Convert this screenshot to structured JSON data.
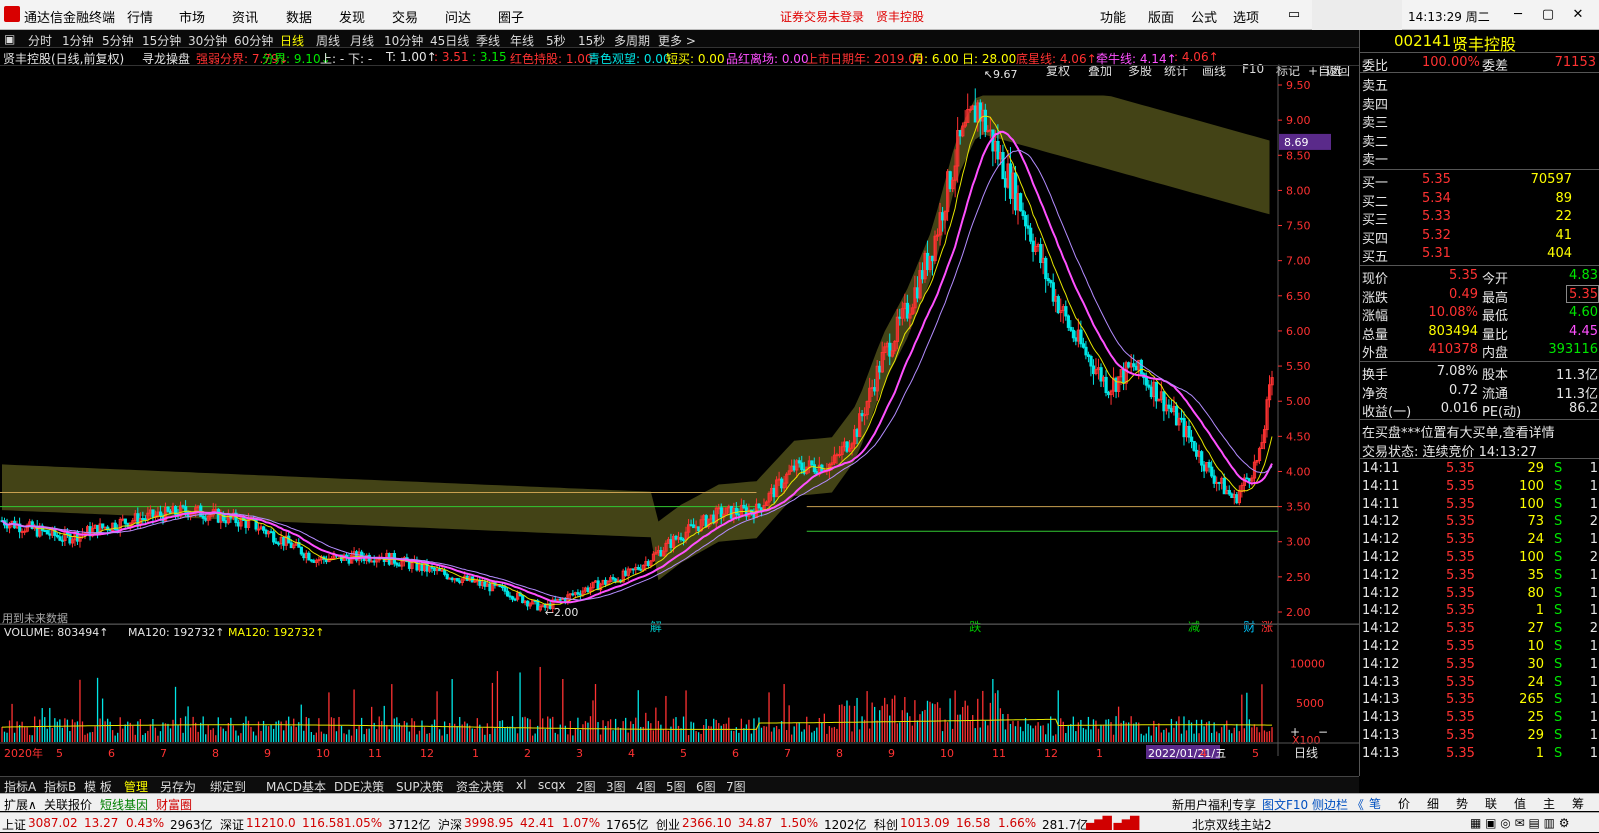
{
  "title_bar": {
    "app_name": "通达信金融终端",
    "menu": [
      "行情",
      "市场",
      "资讯",
      "数据",
      "发现",
      "交易",
      "问达",
      "圈子"
    ],
    "notice_login": "证券交易未登录",
    "notice_stock": "贤丰控股",
    "right_menu": [
      "功能",
      "版面",
      "公式",
      "选项"
    ],
    "clock": "14:13:29 周二"
  },
  "period_bar": {
    "items": [
      "分时",
      "1分钟",
      "5分钟",
      "15分钟",
      "30分钟",
      "60分钟",
      "日线",
      "周线",
      "月线",
      "10分钟",
      "45日线",
      "季线",
      "年线",
      "5秒",
      "15秒",
      "多周期",
      "更多 >"
    ],
    "active": "日线",
    "tool_buttons": [
      "复权",
      "叠加",
      "多股",
      "统计",
      "画线",
      "F10",
      "标记",
      "+自选",
      "返回"
    ]
  },
  "info_bar": {
    "stock_title": "贤丰控股(日线,前复权)",
    "indicator": "寻龙操盘",
    "items": [
      {
        "text": "强弱分界: 7.79↓",
        "color": "#ff3232"
      },
      {
        "text": "分界: 9.10↓",
        "color": "#00e600"
      },
      {
        "text": "上: - 下: -",
        "color": "#e6e6e6"
      },
      {
        "text": "T: 1.00↑",
        "color": "#e6e6e6"
      },
      {
        "text": ": 3.51",
        "color": "#ff3232"
      },
      {
        "text": ": 3.15",
        "color": "#00e600"
      },
      {
        "text": "红色持股: 1.00",
        "color": "#ff3232"
      },
      {
        "text": "青色观望: 0.00",
        "color": "#00e6e6"
      },
      {
        "text": "短买: 0.00",
        "color": "#ffff00"
      },
      {
        "text": "品红离场: 0.00",
        "color": "#ff50ff"
      },
      {
        "text": "上市日期年: 2019.00",
        "color": "#ff3232"
      },
      {
        "text": "月: 6.00",
        "color": "#ffff00"
      },
      {
        "text": "日: 28.00",
        "color": "#ffff00"
      },
      {
        "text": "底星线: 4.06↑",
        "color": "#ff3232"
      },
      {
        "text": "牵牛线: 4.14↑",
        "color": "#ff50ff"
      },
      {
        "text": ": 4.06↑",
        "color": "#ff3232"
      }
    ]
  },
  "chart": {
    "high_label": "9.67",
    "low_label": "2.00",
    "future_note": "用到未来数据",
    "price_axis": [
      "9.50",
      "9.00",
      "8.50",
      "8.00",
      "7.50",
      "7.00",
      "6.50",
      "6.00",
      "5.50",
      "5.00",
      "4.50",
      "4.00",
      "3.50",
      "3.00",
      "2.50",
      "2.00"
    ],
    "current_price_tag": "8.69",
    "markers": [
      "解",
      "跌",
      "减",
      "财",
      "涨"
    ],
    "date_axis": [
      "2020年",
      "5",
      "6",
      "7",
      "8",
      "9",
      "10",
      "11",
      "12",
      "1",
      "2",
      "3",
      "4",
      "5",
      "6",
      "7",
      "8",
      "9",
      "10",
      "11",
      "12",
      "1",
      "2022/01/21/五",
      "4",
      "5"
    ],
    "period_label": "日线"
  },
  "volume_bar": {
    "label": "VOLUME: 803494↑",
    "ma1": "MA120: 192732↑",
    "ma2": "MA120: 192732↑",
    "axis": [
      "10000",
      "5000",
      "X100"
    ]
  },
  "bottom_tabs": [
    "指标A",
    "指标B",
    "模 板",
    "管理",
    "另存为",
    "绑定到",
    "MACD基本",
    "DDE决策",
    "SUP决策",
    "资金决策",
    "xl",
    "scqx",
    "2图",
    "3图",
    "4图",
    "5图",
    "6图",
    "7图"
  ],
  "bottom_bar2": {
    "left": [
      "扩展∧",
      "关联报价",
      "短线基因",
      "财富圈"
    ],
    "right": [
      "新用户福利专享",
      "图文F10",
      "侧边栏 《"
    ]
  },
  "status_bar": [
    {
      "label": "上证",
      "value": "3087.02",
      "change": "13.27",
      "pct": "0.43%",
      "amount": "2963亿"
    },
    {
      "label": "深证",
      "value": "11210.0",
      "change": "116.58",
      "pct": "1.05%",
      "amount": "3712亿"
    },
    {
      "label": "沪深",
      "value": "3998.95",
      "change": "42.41",
      "pct": "1.07%",
      "amount": "1765亿"
    },
    {
      "label": "创业",
      "value": "2366.10",
      "change": "34.87",
      "pct": "1.50%",
      "amount": "1202亿"
    },
    {
      "label": "科创",
      "value": "1013.09",
      "change": "16.58",
      "pct": "1.66%",
      "amount": "281.7亿"
    }
  ],
  "status_right": "北京双线主站2",
  "quote_panel": {
    "code": "002141",
    "name": "贤丰控股",
    "weibi_label": "委比",
    "weibi_value": "100.00%",
    "weicha_label": "委差",
    "weicha_value": "71153",
    "asks": [
      "卖五",
      "卖四",
      "卖三",
      "卖二",
      "卖一"
    ],
    "bids": [
      {
        "label": "买一",
        "price": "5.35",
        "vol": "70597"
      },
      {
        "label": "买二",
        "price": "5.34",
        "vol": "89"
      },
      {
        "label": "买三",
        "price": "5.33",
        "vol": "22"
      },
      {
        "label": "买四",
        "price": "5.32",
        "vol": "41"
      },
      {
        "label": "买五",
        "price": "5.31",
        "vol": "404"
      }
    ],
    "stats": [
      {
        "l1": "现价",
        "v1": "5.35",
        "c1": "#ff3232",
        "l2": "今开",
        "v2": "4.83",
        "c2": "#00e600"
      },
      {
        "l1": "涨跌",
        "v1": "0.49",
        "c1": "#ff3232",
        "l2": "最高",
        "v2": "5.35",
        "c2": "#ff3232"
      },
      {
        "l1": "涨幅",
        "v1": "10.08%",
        "c1": "#ff3232",
        "l2": "最低",
        "v2": "4.60",
        "c2": "#00e600"
      },
      {
        "l1": "总量",
        "v1": "803494",
        "c1": "#ffff00",
        "l2": "量比",
        "v2": "4.45",
        "c2": "#ff50ff"
      },
      {
        "l1": "外盘",
        "v1": "410378",
        "c1": "#ff3232",
        "l2": "内盘",
        "v2": "393116",
        "c2": "#00e600"
      }
    ],
    "stats2": [
      {
        "l1": "换手",
        "v1": "7.08%",
        "l2": "股本",
        "v2": "11.3亿"
      },
      {
        "l1": "净资",
        "v1": "0.72",
        "l2": "流通",
        "v2": "11.3亿"
      },
      {
        "l1": "收益(一)",
        "v1": "0.016",
        "l2": "PE(动)",
        "v2": "86.2"
      }
    ],
    "notice": "在买盘***位置有大买单,查看详情",
    "trade_state": "交易状态: 连续竞价 14:13:27",
    "ticks": [
      {
        "t": "14:11",
        "p": "5.35",
        "v": "29",
        "s": "S",
        "n": "1"
      },
      {
        "t": "14:11",
        "p": "5.35",
        "v": "100",
        "s": "S",
        "n": "1"
      },
      {
        "t": "14:11",
        "p": "5.35",
        "v": "100",
        "s": "S",
        "n": "1"
      },
      {
        "t": "14:12",
        "p": "5.35",
        "v": "73",
        "s": "S",
        "n": "2"
      },
      {
        "t": "14:12",
        "p": "5.35",
        "v": "24",
        "s": "S",
        "n": "1"
      },
      {
        "t": "14:12",
        "p": "5.35",
        "v": "100",
        "s": "S",
        "n": "2"
      },
      {
        "t": "14:12",
        "p": "5.35",
        "v": "35",
        "s": "S",
        "n": "1"
      },
      {
        "t": "14:12",
        "p": "5.35",
        "v": "80",
        "s": "S",
        "n": "1"
      },
      {
        "t": "14:12",
        "p": "5.35",
        "v": "1",
        "s": "S",
        "n": "1"
      },
      {
        "t": "14:12",
        "p": "5.35",
        "v": "27",
        "s": "S",
        "n": "2"
      },
      {
        "t": "14:12",
        "p": "5.35",
        "v": "10",
        "s": "S",
        "n": "1"
      },
      {
        "t": "14:12",
        "p": "5.35",
        "v": "30",
        "s": "S",
        "n": "1"
      },
      {
        "t": "14:13",
        "p": "5.35",
        "v": "24",
        "s": "S",
        "n": "1"
      },
      {
        "t": "14:13",
        "p": "5.35",
        "v": "265",
        "s": "S",
        "n": "1"
      },
      {
        "t": "14:13",
        "p": "5.35",
        "v": "25",
        "s": "S",
        "n": "1"
      },
      {
        "t": "14:13",
        "p": "5.35",
        "v": "29",
        "s": "S",
        "n": "1"
      },
      {
        "t": "14:13",
        "p": "5.35",
        "v": "1",
        "s": "S",
        "n": "1"
      }
    ],
    "tabs": [
      "笔",
      "价",
      "细",
      "势",
      "联",
      "值",
      "主",
      "筹"
    ]
  },
  "colors": {
    "up": "#ff3232",
    "down": "#00e6e6",
    "ma_magenta": "#ff50ff",
    "ma_yellow": "#e6e600",
    "band": "#5a5a1e"
  }
}
